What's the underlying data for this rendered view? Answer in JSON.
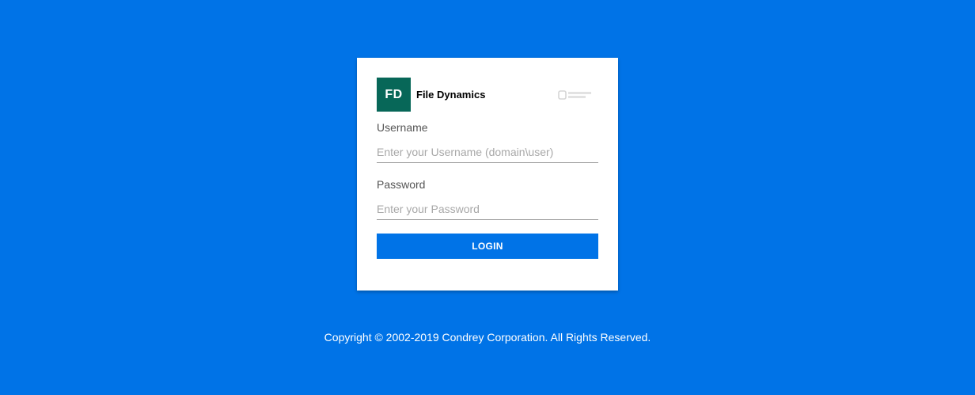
{
  "colors": {
    "background": "#0073e7",
    "card": "#ffffff",
    "logo_tile": "#076758",
    "button": "#0073e7"
  },
  "brand": {
    "logo_initials": "FD",
    "product_name": "File Dynamics",
    "vendor_logo": "micro-focus-logo"
  },
  "form": {
    "username": {
      "label": "Username",
      "placeholder": "Enter your Username (domain\\user)",
      "value": ""
    },
    "password": {
      "label": "Password",
      "placeholder": "Enter your Password",
      "value": ""
    },
    "login_label": "LOGIN"
  },
  "footer": {
    "copyright": "Copyright © 2002-2019 Condrey Corporation. All Rights Reserved."
  }
}
